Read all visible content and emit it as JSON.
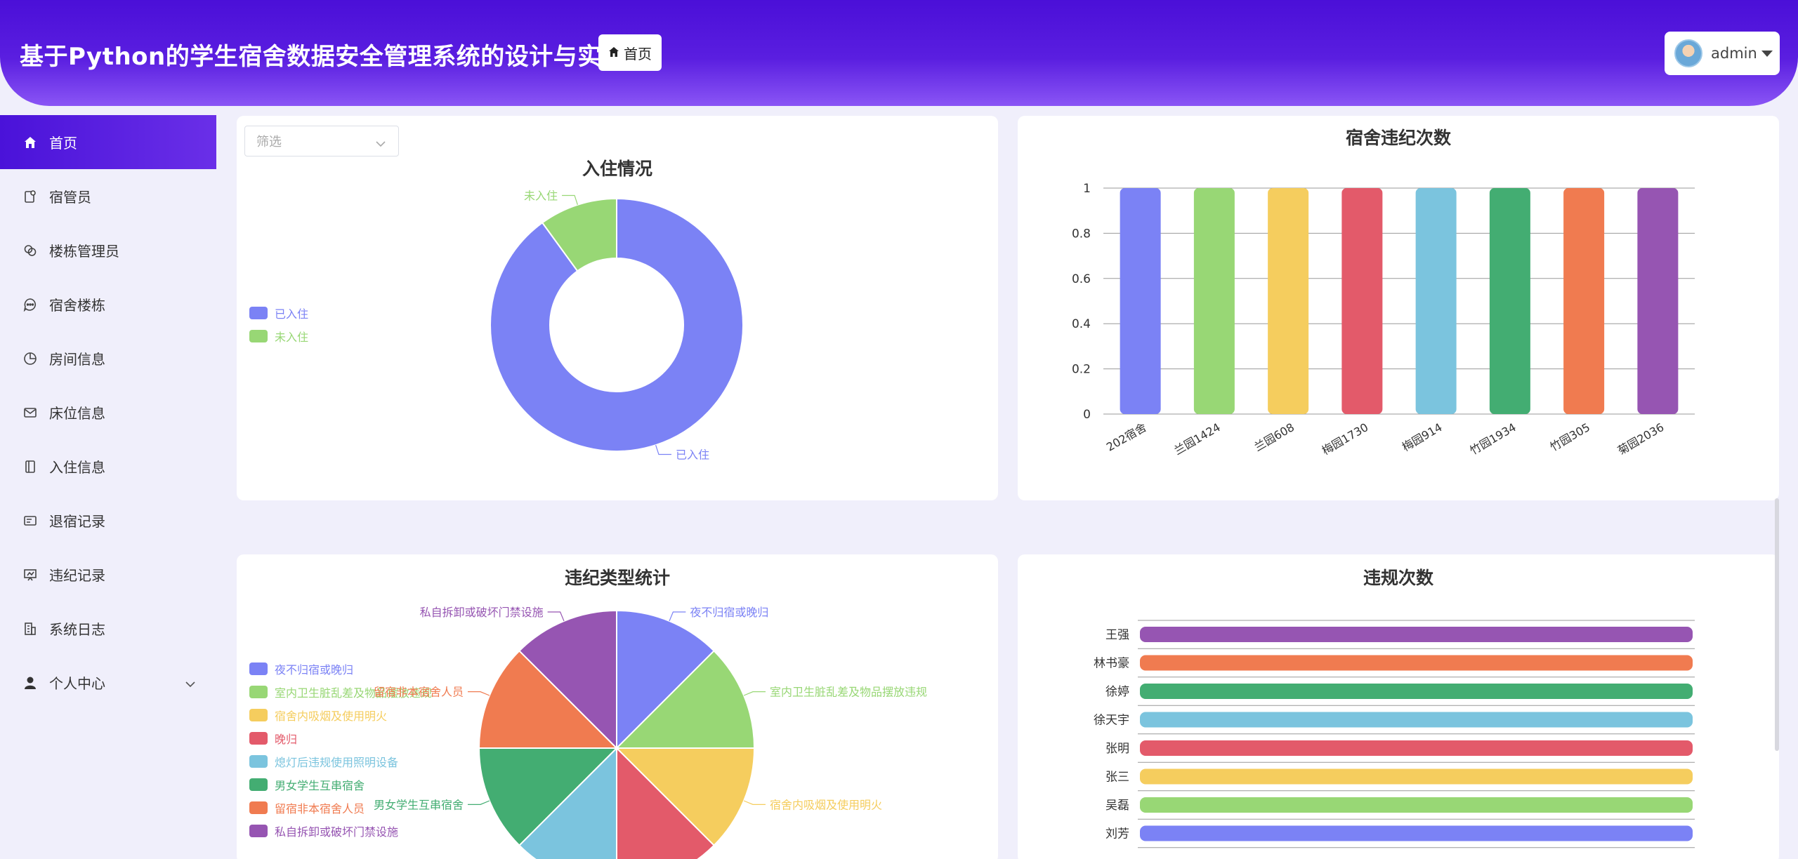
{
  "header": {
    "title": "基于Python的学生宿舍数据安全管理系统的设计与实现",
    "home_label": "首页",
    "user_name": "admin"
  },
  "sidebar": {
    "items": [
      {
        "label": "首页",
        "icon": "home-icon"
      },
      {
        "label": "宿管员",
        "icon": "person-card-icon"
      },
      {
        "label": "楼栋管理员",
        "icon": "link-icon"
      },
      {
        "label": "宿舍楼栋",
        "icon": "chat-icon"
      },
      {
        "label": "房间信息",
        "icon": "pie-icon"
      },
      {
        "label": "床位信息",
        "icon": "mail-icon"
      },
      {
        "label": "入住信息",
        "icon": "notebook-icon"
      },
      {
        "label": "退宿记录",
        "icon": "id-card-icon"
      },
      {
        "label": "违纪记录",
        "icon": "presentation-icon"
      },
      {
        "label": "系统日志",
        "icon": "building-icon"
      },
      {
        "label": "个人中心",
        "icon": "user-icon"
      }
    ]
  },
  "filter": {
    "placeholder": "筛选"
  },
  "colors": {
    "c1": "#7b82f5",
    "c2": "#98d775",
    "c3": "#f5cd5e",
    "c4": "#e35a6a",
    "c5": "#7bc4de",
    "c6": "#43ad72",
    "c7": "#f07b50",
    "c8": "#9655b2"
  },
  "chart_data": [
    {
      "type": "pie",
      "title": "入住情况",
      "labels": [
        "已入住",
        "未入住"
      ],
      "values": [
        90,
        10
      ],
      "donut": true,
      "legend": "left"
    },
    {
      "type": "bar",
      "title": "宿舍违纪次数",
      "categories": [
        "202宿舍",
        "兰园1424",
        "兰园608",
        "梅园1730",
        "梅园914",
        "竹园1934",
        "竹园305",
        "菊园2036"
      ],
      "values": [
        1,
        1,
        1,
        1,
        1,
        1,
        1,
        1
      ],
      "ylim": [
        0,
        1
      ],
      "yticks": [
        "0",
        "0.2",
        "0.4",
        "0.6",
        "0.8",
        "1"
      ],
      "grid": true
    },
    {
      "type": "pie",
      "title": "违纪类型统计",
      "labels": [
        "夜不归宿或晚归",
        "室内卫生脏乱差及物品摆放违规",
        "宿舍内吸烟及使用明火",
        "晚归",
        "熄灯后违规使用照明设备",
        "男女学生互串宿舍",
        "留宿非本宿舍人员",
        "私自拆卸或破坏门禁设施"
      ],
      "values": [
        1,
        1,
        1,
        1,
        1,
        1,
        1,
        1
      ],
      "legend": "left"
    },
    {
      "type": "bar",
      "orientation": "horizontal",
      "title": "违规次数",
      "categories": [
        "王强",
        "林书豪",
        "徐婷",
        "徐天宇",
        "张明",
        "张三",
        "吴磊",
        "刘芳"
      ],
      "values": [
        1,
        1,
        1,
        1,
        1,
        1,
        1,
        1
      ],
      "grid": true
    }
  ]
}
